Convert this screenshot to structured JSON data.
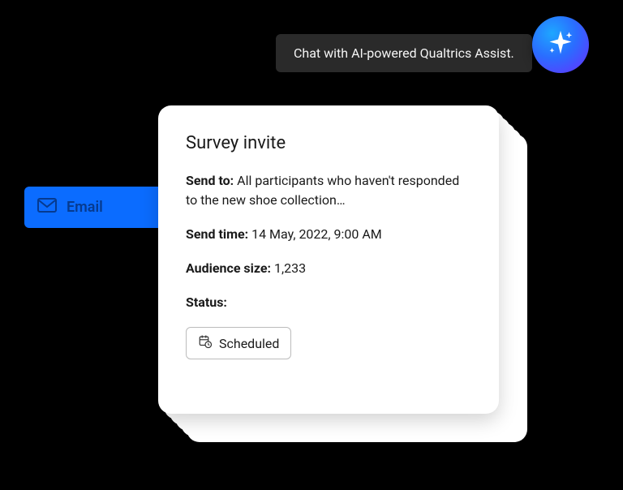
{
  "tooltip": {
    "text": "Chat with AI-powered Qualtrics Assist."
  },
  "email_tab": {
    "label": "Email"
  },
  "card": {
    "title": "Survey invite",
    "fields": {
      "send_to": {
        "label": "Send to:",
        "value": "All participants who haven't responded to the new shoe collection…"
      },
      "send_time": {
        "label": "Send time:",
        "value": "14 May, 2022, 9:00 AM"
      },
      "audience_size": {
        "label": "Audience size:",
        "value": "1,233"
      },
      "status": {
        "label": "Status:"
      }
    },
    "status_badge": "Scheduled"
  }
}
